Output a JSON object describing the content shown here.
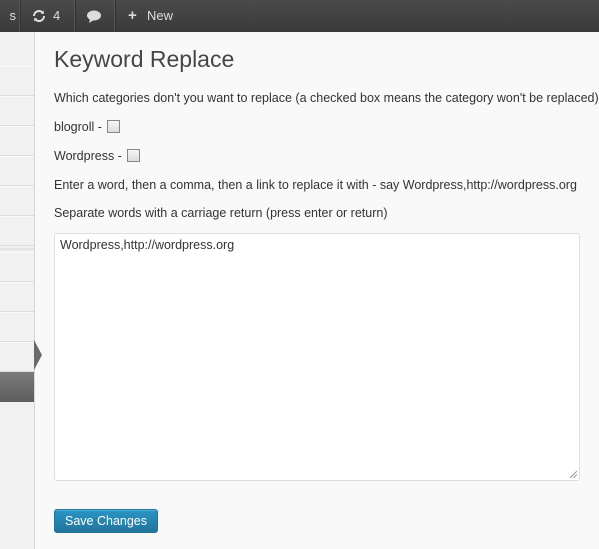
{
  "adminbar": {
    "sites_label": "s",
    "updates_count": "4",
    "new_label": "New",
    "plus_glyph": "+",
    "icons": [
      "updates-icon",
      "comments-icon",
      "plus-icon"
    ]
  },
  "page": {
    "title": "Keyword Replace",
    "categories_intro": "Which categories don't you want to replace (a checked box means the category won't be replaced)",
    "categories": [
      {
        "label": "blogroll -",
        "checked": false
      },
      {
        "label": "Wordpress -",
        "checked": false
      }
    ],
    "instruction_1": "Enter a word, then a comma, then a link to replace it with - say Wordpress,http://wordpress.org",
    "instruction_2": "Separate words with a carriage return (press enter or return)",
    "textarea_value": "Wordpress,http://wordpress.org",
    "save_label": "Save Changes"
  },
  "colors": {
    "adminbar_bg": "#464646",
    "primary_button": "#21759b",
    "page_bg": "#f9f9f9"
  }
}
